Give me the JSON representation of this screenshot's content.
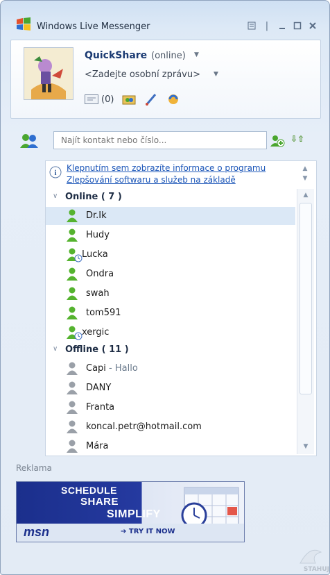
{
  "window": {
    "title": "Windows Live Messenger",
    "controls": [
      "settings",
      "minimize",
      "maximize",
      "close"
    ]
  },
  "profile": {
    "name": "QuickShare",
    "status": "(online)",
    "personal_message": "<Zadejte osobní zprávu>",
    "mail_count": "(0)"
  },
  "search": {
    "placeholder": "Najít kontakt nebo číslo..."
  },
  "info_banner": {
    "line1": "Klepnutím sem zobrazíte informace o programu",
    "line2": "Zlepšování softwaru a služeb na základě"
  },
  "groups": [
    {
      "title": "Online ( 7 )",
      "contacts": [
        {
          "name": "Dr.Ik",
          "status": "online",
          "selected": true
        },
        {
          "name": "Hudy",
          "status": "online"
        },
        {
          "name": "Lucka",
          "status": "away"
        },
        {
          "name": "Ondra",
          "status": "online"
        },
        {
          "name": "swah",
          "status": "online"
        },
        {
          "name": "tom591",
          "status": "online"
        },
        {
          "name": "xergic",
          "status": "away"
        }
      ]
    },
    {
      "title": "Offline ( 11 )",
      "contacts": [
        {
          "name": "Capi",
          "sub": " - Hallo",
          "status": "offline"
        },
        {
          "name": "DANY",
          "status": "offline"
        },
        {
          "name": "Franta",
          "status": "offline"
        },
        {
          "name": "koncal.petr@hotmail.com",
          "status": "offline"
        },
        {
          "name": "Mára",
          "status": "offline"
        }
      ]
    }
  ],
  "ad": {
    "label": "Reklama",
    "line1": "SCHEDULE",
    "line2": "SHARE",
    "line3": "SIMPLIFY",
    "brand": "msn",
    "cta": "TRY IT NOW"
  },
  "watermark": "STAHUJ"
}
